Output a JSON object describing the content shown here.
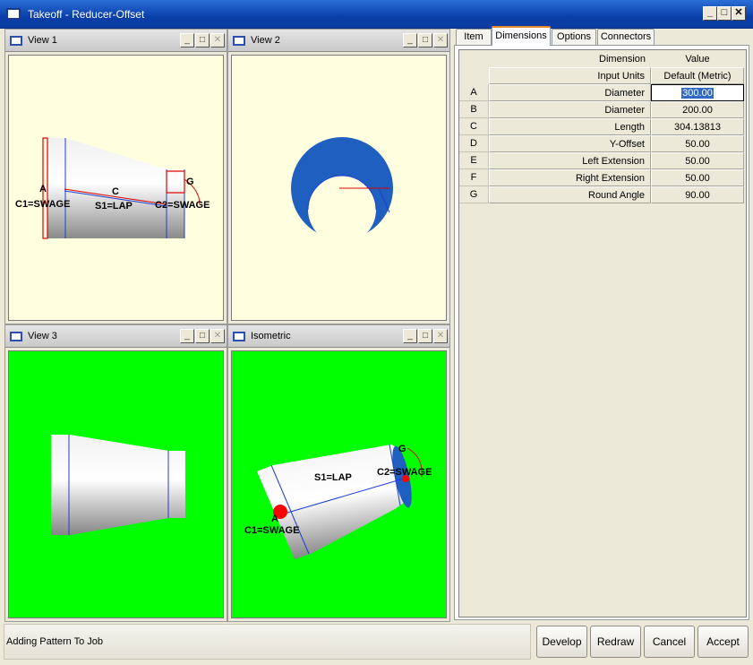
{
  "window": {
    "title": "Takeoff - Reducer-Offset",
    "controls": {
      "minimize": "_",
      "maximize": "□",
      "close": "✕"
    }
  },
  "views": [
    {
      "title": "View 1",
      "background": "#ffffe0",
      "labels": {
        "a": "A",
        "c": "C",
        "g": "G",
        "c1": "C1=SWAGE",
        "s1": "S1=LAP",
        "c2": "C2=SWAGE"
      }
    },
    {
      "title": "View 2",
      "background": "#ffffe0"
    },
    {
      "title": "View 3",
      "background": "#00ff00"
    },
    {
      "title": "Isometric",
      "background": "#00ff00",
      "labels": {
        "g": "G",
        "c2": "C2=SWAGE",
        "s1": "S1=LAP",
        "a": "A",
        "c1": "C1=SWAGE"
      }
    }
  ],
  "view_buttons": {
    "minimize": "_",
    "maximize": "□",
    "close": "✕"
  },
  "tabs": [
    {
      "label": "Item",
      "active": false
    },
    {
      "label": "Dimensions",
      "active": true
    },
    {
      "label": "Options",
      "active": false
    },
    {
      "label": "Connectors",
      "active": false
    }
  ],
  "dimensions_grid": {
    "header": {
      "dimension": "Dimension",
      "value": "Value"
    },
    "units_row": {
      "dimension": "Input Units",
      "value": "Default (Metric)"
    },
    "rows": [
      {
        "id": "A",
        "dimension": "Diameter",
        "value": "300.00",
        "editing": true
      },
      {
        "id": "B",
        "dimension": "Diameter",
        "value": "200.00"
      },
      {
        "id": "C",
        "dimension": "Length",
        "value": "304.13813"
      },
      {
        "id": "D",
        "dimension": "Y-Offset",
        "value": "50.00"
      },
      {
        "id": "E",
        "dimension": "Left Extension",
        "value": "50.00"
      },
      {
        "id": "F",
        "dimension": "Right Extension",
        "value": "50.00"
      },
      {
        "id": "G",
        "dimension": "Round Angle",
        "value": "90.00"
      }
    ]
  },
  "status": {
    "text": "Adding Pattern To Job"
  },
  "actions": {
    "develop": "Develop",
    "redraw": "Redraw",
    "cancel": "Cancel",
    "accept": "Accept"
  },
  "colors": {
    "titlebar": "#0a3fa9",
    "view_yellow": "#ffffe0",
    "view_green": "#00ff00",
    "model_blue": "#1e5fc0",
    "edge_red": "#e00000"
  }
}
